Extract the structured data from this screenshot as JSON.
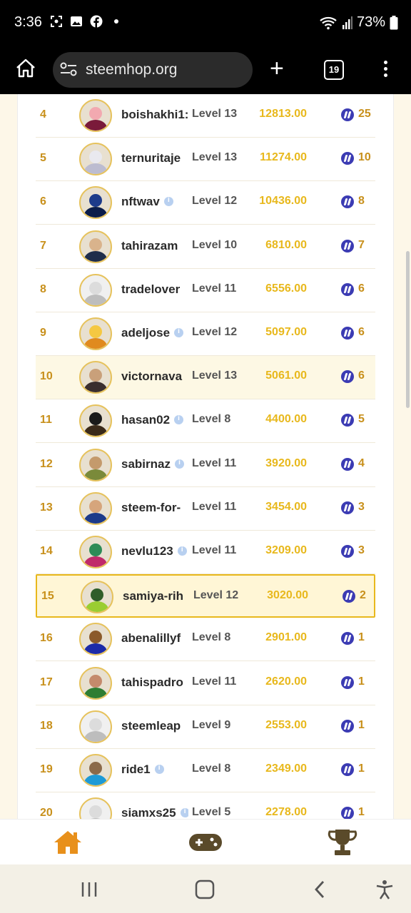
{
  "status_bar": {
    "time": "3:36",
    "battery": "73%",
    "icons": [
      "screenshot-icon",
      "gallery-icon",
      "facebook-icon",
      "dot-icon",
      "wifi-icon",
      "signal-icon",
      "battery-icon"
    ]
  },
  "browser": {
    "url": "steemhop.org",
    "tab_count": "19",
    "plus_label": "+"
  },
  "leaderboard": {
    "rows": [
      {
        "rank": "4",
        "username": "boishakhi1:",
        "verified": false,
        "level": "Level 13",
        "score": "12813.00",
        "coins": "25"
      },
      {
        "rank": "5",
        "username": "ternuritaje",
        "verified": false,
        "level": "Level 13",
        "score": "11274.00",
        "coins": "10"
      },
      {
        "rank": "6",
        "username": "nftwav",
        "verified": true,
        "level": "Level 12",
        "score": "10436.00",
        "coins": "8"
      },
      {
        "rank": "7",
        "username": "tahirazam",
        "verified": false,
        "level": "Level 10",
        "score": "6810.00",
        "coins": "7"
      },
      {
        "rank": "8",
        "username": "tradelover",
        "verified": false,
        "level": "Level 11",
        "score": "6556.00",
        "coins": "6"
      },
      {
        "rank": "9",
        "username": "adeljose",
        "verified": true,
        "level": "Level 12",
        "score": "5097.00",
        "coins": "6"
      },
      {
        "rank": "10",
        "username": "victornava",
        "verified": false,
        "level": "Level 13",
        "score": "5061.00",
        "coins": "6"
      },
      {
        "rank": "11",
        "username": "hasan02",
        "verified": true,
        "level": "Level 8",
        "score": "4400.00",
        "coins": "5"
      },
      {
        "rank": "12",
        "username": "sabirnaz",
        "verified": true,
        "level": "Level 11",
        "score": "3920.00",
        "coins": "4"
      },
      {
        "rank": "13",
        "username": "steem-for-",
        "verified": false,
        "level": "Level 11",
        "score": "3454.00",
        "coins": "3"
      },
      {
        "rank": "14",
        "username": "nevlu123",
        "verified": true,
        "level": "Level 11",
        "score": "3209.00",
        "coins": "3"
      },
      {
        "rank": "15",
        "username": "samiya-rih",
        "verified": false,
        "level": "Level 12",
        "score": "3020.00",
        "coins": "2"
      },
      {
        "rank": "16",
        "username": "abenalillyf",
        "verified": false,
        "level": "Level 8",
        "score": "2901.00",
        "coins": "1"
      },
      {
        "rank": "17",
        "username": "tahispadro",
        "verified": false,
        "level": "Level 11",
        "score": "2620.00",
        "coins": "1"
      },
      {
        "rank": "18",
        "username": "steemleap",
        "verified": false,
        "level": "Level 9",
        "score": "2553.00",
        "coins": "1"
      },
      {
        "rank": "19",
        "username": "ride1",
        "verified": true,
        "level": "Level 8",
        "score": "2349.00",
        "coins": "1"
      },
      {
        "rank": "20",
        "username": "siamxs25",
        "verified": true,
        "level": "Level 5",
        "score": "2278.00",
        "coins": "1"
      }
    ]
  },
  "bottom_nav": {
    "items": [
      "home-icon",
      "gamepad-icon",
      "trophy-icon"
    ],
    "active": "home-icon"
  },
  "colors": {
    "accent": "#e8b81c",
    "rank": "#c8901b",
    "steem": "#3b3bb3",
    "nav_active": "#e8901b",
    "page_bg": "#fdf7e8"
  }
}
